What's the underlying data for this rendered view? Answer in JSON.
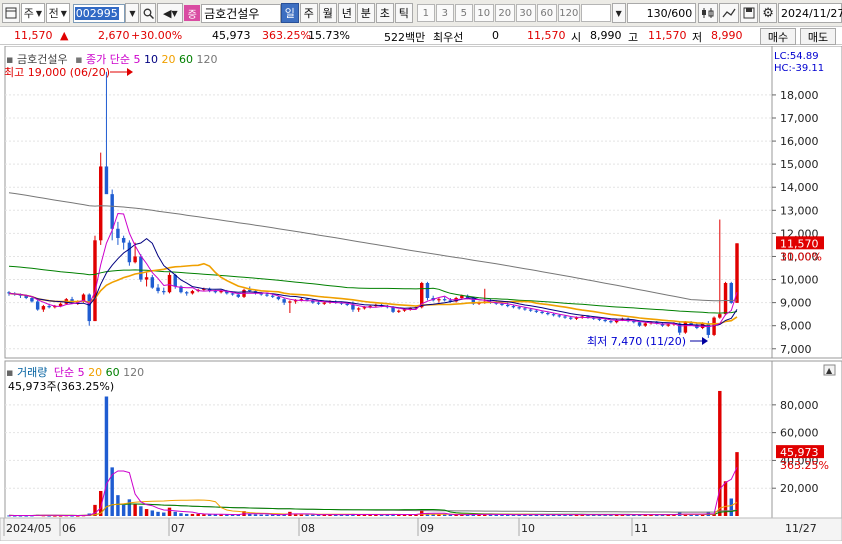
{
  "toolbar": {
    "type_label": "주",
    "type2_label": "전",
    "stock_code": "002995",
    "market_badge": "증",
    "stock_name": "금호건설우",
    "periods": [
      {
        "label": "일",
        "active": true
      },
      {
        "label": "주",
        "active": false
      },
      {
        "label": "월",
        "active": false
      },
      {
        "label": "년",
        "active": false
      },
      {
        "label": "분",
        "active": false
      },
      {
        "label": "초",
        "active": false
      },
      {
        "label": "틱",
        "active": false
      }
    ],
    "intervals": [
      "1",
      "3",
      "5",
      "10",
      "20",
      "30",
      "60",
      "120"
    ],
    "count": "130/600",
    "date": "2024/11/27"
  },
  "quote": {
    "price": "11,570",
    "change": "2,670",
    "change_pct": "+30.00%",
    "volume": "45,973",
    "volume_ratio": "363.25%",
    "turnover": "15.73%",
    "amount": "522백만",
    "label_priority": "최우선",
    "priority_qty": "0",
    "priority_price": "11,570",
    "open_label": "시",
    "open": "8,990",
    "high_label": "고",
    "high": "11,570",
    "low_label": "저",
    "low": "8,990",
    "buy_label": "매수",
    "sell_label": "매도"
  },
  "price_panel": {
    "legend_name": "금호건설우",
    "legend_type": "종가 단순",
    "ma_periods": [
      "5",
      "10",
      "20",
      "60",
      "120"
    ],
    "lc": "LC:54.89",
    "hc": "HC:-39.11",
    "max_label": "최고 19,000 (06/20)",
    "min_label": "최저 7,470 (11/20)",
    "last_price": "11,570",
    "last_pct": "30.00%",
    "y_ticks": [
      "18,000",
      "17,000",
      "16,000",
      "15,000",
      "14,000",
      "13,000",
      "12,000",
      "11,000",
      "10,000",
      "9,000",
      "8,000",
      "7,000"
    ]
  },
  "volume_panel": {
    "legend_name": "거래량",
    "legend_type": "단순",
    "ma_periods": [
      "5",
      "20",
      "60",
      "120"
    ],
    "current": "45,973주(363.25%)",
    "last_value": "45,973",
    "last_pct": "363.25%",
    "y_ticks": [
      "80,000",
      "60,000",
      "40,000",
      "20,000"
    ]
  },
  "x_axis": {
    "labels": [
      "2024/05",
      "06",
      "07",
      "08",
      "09",
      "10",
      "11"
    ],
    "right_label": "11/27"
  },
  "colors": {
    "up": "#e00000",
    "down": "#1f5cd1",
    "ma5": "#cc00cc",
    "ma10": "#000080",
    "ma20": "#f0a000",
    "ma60": "#008000",
    "ma120": "#777777"
  },
  "chart_data": {
    "type": "candlestick",
    "price_range": [
      6600,
      19600
    ],
    "volume_range": [
      0,
      95000
    ],
    "candles": [
      {
        "o": 9450,
        "h": 9500,
        "l": 9300,
        "c": 9400
      },
      {
        "o": 9400,
        "h": 9450,
        "l": 9300,
        "c": 9350
      },
      {
        "o": 9350,
        "h": 9400,
        "l": 9200,
        "c": 9300
      },
      {
        "o": 9300,
        "h": 9350,
        "l": 9150,
        "c": 9200
      },
      {
        "o": 9200,
        "h": 9250,
        "l": 9000,
        "c": 9050
      },
      {
        "o": 9050,
        "h": 9150,
        "l": 8650,
        "c": 8700
      },
      {
        "o": 8700,
        "h": 8900,
        "l": 8600,
        "c": 8850
      },
      {
        "o": 8850,
        "h": 8950,
        "l": 8750,
        "c": 8800
      },
      {
        "o": 8800,
        "h": 8900,
        "l": 8750,
        "c": 8850
      },
      {
        "o": 8850,
        "h": 9000,
        "l": 8800,
        "c": 8950
      },
      {
        "o": 8950,
        "h": 9200,
        "l": 8900,
        "c": 9150
      },
      {
        "o": 9150,
        "h": 9250,
        "l": 8950,
        "c": 9000
      },
      {
        "o": 9000,
        "h": 9100,
        "l": 8900,
        "c": 9050
      },
      {
        "o": 9050,
        "h": 9400,
        "l": 9000,
        "c": 9350
      },
      {
        "o": 9350,
        "h": 9400,
        "l": 8000,
        "c": 8200
      },
      {
        "o": 8200,
        "h": 11900,
        "l": 8200,
        "c": 11700
      },
      {
        "o": 11700,
        "h": 15500,
        "l": 11500,
        "c": 14900
      },
      {
        "o": 14900,
        "h": 19000,
        "l": 14200,
        "c": 13700
      },
      {
        "o": 13700,
        "h": 13900,
        "l": 11700,
        "c": 12200
      },
      {
        "o": 12200,
        "h": 12500,
        "l": 11500,
        "c": 11800
      },
      {
        "o": 11800,
        "h": 11900,
        "l": 11300,
        "c": 11600
      },
      {
        "o": 11600,
        "h": 11700,
        "l": 10600,
        "c": 10750
      },
      {
        "o": 10750,
        "h": 11600,
        "l": 10700,
        "c": 11000
      },
      {
        "o": 11000,
        "h": 11100,
        "l": 9900,
        "c": 10000
      },
      {
        "o": 10000,
        "h": 10300,
        "l": 9700,
        "c": 10100
      },
      {
        "o": 10100,
        "h": 10200,
        "l": 9600,
        "c": 9650
      },
      {
        "o": 9650,
        "h": 9800,
        "l": 9400,
        "c": 9500
      },
      {
        "o": 9500,
        "h": 9650,
        "l": 9350,
        "c": 9450
      },
      {
        "o": 9450,
        "h": 10300,
        "l": 9400,
        "c": 10200
      },
      {
        "o": 10200,
        "h": 10250,
        "l": 9600,
        "c": 9700
      },
      {
        "o": 9700,
        "h": 9750,
        "l": 9400,
        "c": 9450
      },
      {
        "o": 9450,
        "h": 9500,
        "l": 9300,
        "c": 9400
      },
      {
        "o": 9400,
        "h": 9550,
        "l": 9350,
        "c": 9500
      },
      {
        "o": 9500,
        "h": 9600,
        "l": 9450,
        "c": 9550
      },
      {
        "o": 9550,
        "h": 9650,
        "l": 9500,
        "c": 9600
      },
      {
        "o": 9600,
        "h": 9650,
        "l": 9450,
        "c": 9500
      },
      {
        "o": 9500,
        "h": 9550,
        "l": 9400,
        "c": 9450
      },
      {
        "o": 9450,
        "h": 9550,
        "l": 9400,
        "c": 9500
      },
      {
        "o": 9500,
        "h": 9550,
        "l": 9350,
        "c": 9400
      },
      {
        "o": 9400,
        "h": 9450,
        "l": 9300,
        "c": 9350
      },
      {
        "o": 9350,
        "h": 9400,
        "l": 9200,
        "c": 9250
      },
      {
        "o": 9250,
        "h": 9600,
        "l": 9200,
        "c": 9550
      },
      {
        "o": 9550,
        "h": 9700,
        "l": 9450,
        "c": 9500
      },
      {
        "o": 9500,
        "h": 9550,
        "l": 9350,
        "c": 9400
      },
      {
        "o": 9400,
        "h": 9450,
        "l": 9300,
        "c": 9350
      },
      {
        "o": 9350,
        "h": 9400,
        "l": 9250,
        "c": 9300
      },
      {
        "o": 9300,
        "h": 9350,
        "l": 9200,
        "c": 9250
      },
      {
        "o": 9250,
        "h": 9300,
        "l": 9100,
        "c": 9150
      },
      {
        "o": 9150,
        "h": 9200,
        "l": 8900,
        "c": 9000
      },
      {
        "o": 9000,
        "h": 9100,
        "l": 8550,
        "c": 9050
      },
      {
        "o": 9050,
        "h": 9150,
        "l": 8950,
        "c": 9100
      },
      {
        "o": 9100,
        "h": 9200,
        "l": 9050,
        "c": 9150
      },
      {
        "o": 9150,
        "h": 9200,
        "l": 9050,
        "c": 9100
      },
      {
        "o": 9100,
        "h": 9150,
        "l": 8950,
        "c": 9000
      },
      {
        "o": 9000,
        "h": 9050,
        "l": 8900,
        "c": 8950
      },
      {
        "o": 8950,
        "h": 9050,
        "l": 8900,
        "c": 9000
      },
      {
        "o": 9000,
        "h": 9100,
        "l": 8950,
        "c": 9050
      },
      {
        "o": 9050,
        "h": 9100,
        "l": 8950,
        "c": 9000
      },
      {
        "o": 9000,
        "h": 9050,
        "l": 8900,
        "c": 8950
      },
      {
        "o": 8950,
        "h": 9000,
        "l": 8850,
        "c": 8900
      },
      {
        "o": 8900,
        "h": 9050,
        "l": 8600,
        "c": 8700
      },
      {
        "o": 8700,
        "h": 8800,
        "l": 8600,
        "c": 8750
      },
      {
        "o": 8750,
        "h": 8850,
        "l": 8700,
        "c": 8800
      },
      {
        "o": 8800,
        "h": 8900,
        "l": 8750,
        "c": 8850
      },
      {
        "o": 8850,
        "h": 8950,
        "l": 8800,
        "c": 8900
      },
      {
        "o": 8900,
        "h": 8950,
        "l": 8800,
        "c": 8850
      },
      {
        "o": 8850,
        "h": 8900,
        "l": 8750,
        "c": 8800
      },
      {
        "o": 8800,
        "h": 8850,
        "l": 8550,
        "c": 8600
      },
      {
        "o": 8600,
        "h": 8700,
        "l": 8550,
        "c": 8650
      },
      {
        "o": 8650,
        "h": 8750,
        "l": 8600,
        "c": 8700
      },
      {
        "o": 8700,
        "h": 8800,
        "l": 8650,
        "c": 8750
      },
      {
        "o": 8750,
        "h": 8850,
        "l": 8700,
        "c": 8800
      },
      {
        "o": 8800,
        "h": 9900,
        "l": 8750,
        "c": 9850
      },
      {
        "o": 9850,
        "h": 9900,
        "l": 9100,
        "c": 9200
      },
      {
        "o": 9200,
        "h": 9300,
        "l": 9050,
        "c": 9100
      },
      {
        "o": 9100,
        "h": 9200,
        "l": 9000,
        "c": 9150
      },
      {
        "o": 9150,
        "h": 9250,
        "l": 9050,
        "c": 9100
      },
      {
        "o": 9100,
        "h": 9200,
        "l": 9000,
        "c": 9050
      },
      {
        "o": 9050,
        "h": 9250,
        "l": 9000,
        "c": 9200
      },
      {
        "o": 9200,
        "h": 9350,
        "l": 9150,
        "c": 9300
      },
      {
        "o": 9300,
        "h": 9350,
        "l": 9150,
        "c": 9200
      },
      {
        "o": 9200,
        "h": 9250,
        "l": 8900,
        "c": 8950
      },
      {
        "o": 8950,
        "h": 9050,
        "l": 8900,
        "c": 9000
      },
      {
        "o": 9000,
        "h": 9600,
        "l": 8950,
        "c": 9050
      },
      {
        "o": 9050,
        "h": 9150,
        "l": 8950,
        "c": 9000
      },
      {
        "o": 9000,
        "h": 9100,
        "l": 8900,
        "c": 8950
      },
      {
        "o": 8950,
        "h": 9000,
        "l": 8850,
        "c": 8900
      },
      {
        "o": 8900,
        "h": 9000,
        "l": 8800,
        "c": 8850
      },
      {
        "o": 8850,
        "h": 8900,
        "l": 8750,
        "c": 8800
      },
      {
        "o": 8800,
        "h": 8850,
        "l": 8700,
        "c": 8750
      },
      {
        "o": 8750,
        "h": 8800,
        "l": 8650,
        "c": 8700
      },
      {
        "o": 8700,
        "h": 8750,
        "l": 8600,
        "c": 8650
      },
      {
        "o": 8650,
        "h": 8700,
        "l": 8550,
        "c": 8600
      },
      {
        "o": 8600,
        "h": 8650,
        "l": 8500,
        "c": 8550
      },
      {
        "o": 8550,
        "h": 8600,
        "l": 8450,
        "c": 8500
      },
      {
        "o": 8500,
        "h": 8550,
        "l": 8400,
        "c": 8450
      },
      {
        "o": 8450,
        "h": 8500,
        "l": 8350,
        "c": 8400
      },
      {
        "o": 8400,
        "h": 8450,
        "l": 8300,
        "c": 8350
      },
      {
        "o": 8350,
        "h": 8400,
        "l": 8250,
        "c": 8300
      },
      {
        "o": 8300,
        "h": 8400,
        "l": 8250,
        "c": 8350
      },
      {
        "o": 8350,
        "h": 8450,
        "l": 8300,
        "c": 8400
      },
      {
        "o": 8400,
        "h": 8450,
        "l": 8300,
        "c": 8350
      },
      {
        "o": 8350,
        "h": 8400,
        "l": 8250,
        "c": 8300
      },
      {
        "o": 8300,
        "h": 8350,
        "l": 8200,
        "c": 8250
      },
      {
        "o": 8250,
        "h": 8300,
        "l": 8150,
        "c": 8200
      },
      {
        "o": 8200,
        "h": 8250,
        "l": 8100,
        "c": 8150
      },
      {
        "o": 8150,
        "h": 8300,
        "l": 8100,
        "c": 8250
      },
      {
        "o": 8250,
        "h": 8350,
        "l": 8200,
        "c": 8300
      },
      {
        "o": 8300,
        "h": 8350,
        "l": 8150,
        "c": 8200
      },
      {
        "o": 8200,
        "h": 8250,
        "l": 8100,
        "c": 8150
      },
      {
        "o": 8150,
        "h": 8200,
        "l": 7950,
        "c": 8000
      },
      {
        "o": 8000,
        "h": 8150,
        "l": 7950,
        "c": 8100
      },
      {
        "o": 8100,
        "h": 8200,
        "l": 8050,
        "c": 8150
      },
      {
        "o": 8150,
        "h": 8200,
        "l": 8050,
        "c": 8100
      },
      {
        "o": 8100,
        "h": 8150,
        "l": 7950,
        "c": 8000
      },
      {
        "o": 8000,
        "h": 8100,
        "l": 7950,
        "c": 8050
      },
      {
        "o": 8050,
        "h": 8150,
        "l": 8000,
        "c": 8100
      },
      {
        "o": 8100,
        "h": 8150,
        "l": 7600,
        "c": 7700
      },
      {
        "o": 7700,
        "h": 8200,
        "l": 7650,
        "c": 8150
      },
      {
        "o": 8150,
        "h": 8200,
        "l": 8000,
        "c": 8050
      },
      {
        "o": 8050,
        "h": 8100,
        "l": 7850,
        "c": 7900
      },
      {
        "o": 7900,
        "h": 8150,
        "l": 7850,
        "c": 8100
      },
      {
        "o": 8100,
        "h": 8200,
        "l": 7470,
        "c": 7600
      },
      {
        "o": 7600,
        "h": 8400,
        "l": 7550,
        "c": 8350
      },
      {
        "o": 8350,
        "h": 12600,
        "l": 8300,
        "c": 8500
      },
      {
        "o": 8500,
        "h": 9900,
        "l": 8450,
        "c": 9850
      },
      {
        "o": 9850,
        "h": 9900,
        "l": 8950,
        "c": 8990
      },
      {
        "o": 8990,
        "h": 11570,
        "l": 8990,
        "c": 11570
      }
    ],
    "volumes": [
      400,
      300,
      300,
      300,
      400,
      900,
      500,
      300,
      300,
      300,
      500,
      300,
      300,
      500,
      1800,
      8000,
      18000,
      86000,
      35000,
      15000,
      8000,
      12000,
      9000,
      7000,
      5000,
      4000,
      3000,
      2500,
      6000,
      3000,
      2000,
      1500,
      1500,
      1500,
      1200,
      1200,
      1200,
      1000,
      1000,
      1000,
      1000,
      3500,
      1500,
      1200,
      1000,
      1000,
      1000,
      1000,
      1200,
      3000,
      1200,
      1000,
      1000,
      1000,
      1000,
      1000,
      1000,
      1000,
      1000,
      1000,
      1500,
      1000,
      1000,
      1000,
      1000,
      1000,
      1000,
      1500,
      1000,
      1000,
      1000,
      1000,
      4500,
      2000,
      1200,
      1000,
      1000,
      1000,
      1000,
      1200,
      1000,
      1200,
      1000,
      1500,
      1000,
      1000,
      1000,
      1000,
      1000,
      1000,
      1000,
      1000,
      1000,
      1000,
      1000,
      1000,
      1000,
      1000,
      1000,
      1000,
      1000,
      1000,
      1000,
      1000,
      1000,
      1000,
      1000,
      1000,
      1000,
      1000,
      1000,
      1200,
      1000,
      1000,
      1000,
      1000,
      1000,
      2500,
      1500,
      1000,
      1000,
      1000,
      3000,
      1500,
      90000,
      25000,
      12600,
      45973
    ]
  }
}
